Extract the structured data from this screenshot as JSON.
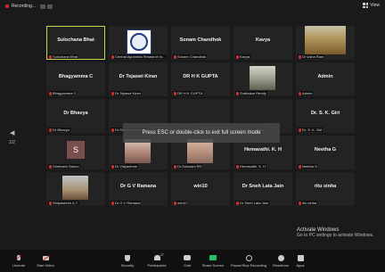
{
  "topbar": {
    "recording_label": "Recording...",
    "view_label": "View"
  },
  "gallery": {
    "tiles": [
      {
        "big": "Sulochana Bhat",
        "name": "Sulochana Bhat",
        "active": true
      },
      {
        "big": "",
        "name": "Central Ayurveda Research In...",
        "visual": "logo-image"
      },
      {
        "big": "Sonam Chandhok",
        "name": "Sonam Chandhok"
      },
      {
        "big": "Kavya",
        "name": "Kavya"
      },
      {
        "big": "",
        "name": "Dr Usha Rani",
        "visual": "photo-5"
      },
      {
        "big": "Bhagyamma C",
        "name": "Bhagyamma C"
      },
      {
        "big": "Dr Tejaswi Kiran",
        "name": "Dr Tejaswi Kiran"
      },
      {
        "big": "DR H K GUPTA",
        "name": "DR H K GUPTA"
      },
      {
        "big": "",
        "name": "Sudhakar Reddy",
        "visual": "photo-4"
      },
      {
        "big": "Admin",
        "name": "Admin"
      },
      {
        "big": "Dr Bhavya",
        "name": "Dr Bhavya"
      },
      {
        "big": "",
        "name": "Dr.Shubhashree M.N",
        "visual": "plain"
      },
      {
        "big": "",
        "name": "SMPU CARI",
        "visual": "plain"
      },
      {
        "big": "",
        "name": "Dr V Rama Rao",
        "visual": "plain"
      },
      {
        "big": "Dr. S. K. Giri",
        "name": "Dr. S. K. Giri"
      },
      {
        "big": "",
        "name": "Srimbach Sahoo",
        "visual": "avatar-s"
      },
      {
        "big": "",
        "name": "Dr Vidyashree",
        "visual": "photo-2"
      },
      {
        "big": "",
        "name": "Dr.Suhasini RD",
        "visual": "photo-3"
      },
      {
        "big": "Hemavathi. K. H",
        "name": "Hemavathi. K. H"
      },
      {
        "big": "Neetha G",
        "name": "Neetha G"
      },
      {
        "big": "",
        "name": "Shilpashree A.T.",
        "visual": "photo-1"
      },
      {
        "big": "Dr G V Ramana",
        "name": "Dr G V Ramana"
      },
      {
        "big": "win10",
        "name": "win10"
      },
      {
        "big": "Dr Sneh Lata Jain",
        "name": "Dr Sneh Lata Jain"
      },
      {
        "big": "ritu sinha",
        "name": "ritu sinha"
      }
    ],
    "avatar_letter": "S"
  },
  "overlay_text": "Press ESC or double-click to exit full screen mode",
  "page_indicator": "1/2",
  "activation": {
    "title": "Activate Windows",
    "subtitle": "Go to PC settings to activate Windows."
  },
  "toolbar": {
    "unmute": "Unmute",
    "start_video": "Start Video",
    "security": "Security",
    "participants": "Participants",
    "participants_count": "27",
    "chat": "Chat",
    "share_screen": "Share Screen",
    "record": "Pause/Stop Recording",
    "reactions": "Reactions",
    "apps": "Apps"
  },
  "colors": {
    "background": "#1a1a1a",
    "tile": "#232323",
    "active_border": "#c8d24a",
    "share_green": "#23c266",
    "record_red": "#e02828"
  }
}
